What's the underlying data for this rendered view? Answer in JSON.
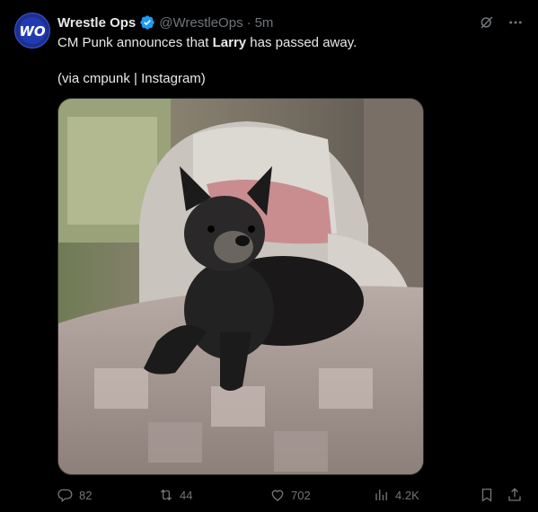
{
  "tweet": {
    "author_name": "Wrestle Ops",
    "handle": "@WrestleOps",
    "separator": "·",
    "time": "5m",
    "avatar_text": "WO",
    "text_before": "CM Punk announces that ",
    "text_bold": "Larry",
    "text_after": " has passed away.",
    "credit": "(via cmpunk | Instagram)"
  },
  "metrics": {
    "replies": "82",
    "reposts": "44",
    "likes": "702",
    "views": "4.2K"
  },
  "icons": {
    "verified": "verified-badge-icon",
    "grok": "grok-icon",
    "more": "more-icon",
    "reply": "reply-icon",
    "repost": "repost-icon",
    "like": "heart-icon",
    "views": "views-chart-icon",
    "bookmark": "bookmark-icon",
    "share": "share-icon"
  },
  "colors": {
    "background": "#000000",
    "text": "#e7e9ea",
    "muted": "#71767b",
    "verified": "#1d9bf0"
  }
}
